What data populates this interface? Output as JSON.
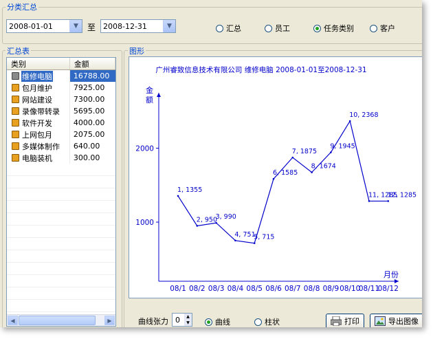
{
  "group": {
    "title": "分类汇总"
  },
  "filters": {
    "date_from": "2008-01-01",
    "to_label": "至",
    "date_to": "2008-12-31",
    "options": [
      {
        "label": "汇总",
        "checked": false
      },
      {
        "label": "员工",
        "checked": false
      },
      {
        "label": "任务类别",
        "checked": true
      },
      {
        "label": "客户",
        "checked": false
      }
    ]
  },
  "summary": {
    "title": "汇总表",
    "columns": [
      "类别",
      "金额"
    ],
    "rows": [
      {
        "category": "维修电脑",
        "amount": "16788.00",
        "selected": true,
        "icon": "gray-box-icon"
      },
      {
        "category": "包月维护",
        "amount": "7925.00",
        "selected": false,
        "icon": "box-icon"
      },
      {
        "category": "网站建设",
        "amount": "7300.00",
        "selected": false,
        "icon": "box-icon"
      },
      {
        "category": "录像带转录",
        "amount": "5695.00",
        "selected": false,
        "icon": "box-icon"
      },
      {
        "category": "软件开发",
        "amount": "4000.00",
        "selected": false,
        "icon": "box-icon"
      },
      {
        "category": "上网包月",
        "amount": "2075.00",
        "selected": false,
        "icon": "box-icon"
      },
      {
        "category": "多媒体制作",
        "amount": "640.00",
        "selected": false,
        "icon": "box-icon"
      },
      {
        "category": "电脑装机",
        "amount": "300.00",
        "selected": false,
        "icon": "box-icon"
      }
    ]
  },
  "graph": {
    "title": "图形"
  },
  "chart_data": {
    "type": "line",
    "title": "广州睿致信息技术有限公司  维修电脑  2008-01-01至2008-12-31",
    "xlabel": "月份",
    "ylabel": "金额",
    "categories": [
      "08/1",
      "08/2",
      "08/3",
      "08/4",
      "08/5",
      "08/6",
      "08/7",
      "08/8",
      "08/9",
      "08/10",
      "08/11",
      "08/12"
    ],
    "values": [
      1355,
      950,
      990,
      751,
      715,
      1585,
      1875,
      1674,
      1945,
      2368,
      1285,
      1285
    ],
    "point_labels": [
      "1, 1355",
      "2, 950",
      "3, 990",
      "4, 751",
      "5, 715",
      "6, 1585",
      "7, 1875",
      "8, 1674",
      "9, 1945",
      "10, 2368",
      "11, 1285",
      "12, 1285"
    ],
    "yticks": [
      1000,
      2000
    ],
    "ylim": [
      200,
      2750
    ],
    "color": "#0000cc"
  },
  "footer": {
    "tension_label": "曲线张力",
    "tension_value": "0",
    "chart_types": [
      {
        "label": "曲线",
        "checked": true
      },
      {
        "label": "柱状",
        "checked": false
      }
    ],
    "print_label": "打印",
    "export_label": "导出图像"
  }
}
